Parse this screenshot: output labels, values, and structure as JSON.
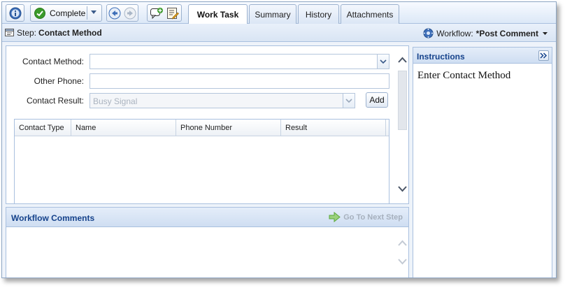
{
  "toolbar": {
    "complete_label": "Complete",
    "icons": [
      "info-icon",
      "check-icon",
      "back-icon",
      "forward-icon",
      "add-comment-icon",
      "edit-list-icon"
    ]
  },
  "tabs": [
    {
      "label": "Work Task",
      "active": true
    },
    {
      "label": "Summary",
      "active": false
    },
    {
      "label": "History",
      "active": false
    },
    {
      "label": "Attachments",
      "active": false
    }
  ],
  "step": {
    "prefix": "Step:",
    "name": "Contact Method",
    "workflow_label": "Workflow:",
    "workflow_value": "*Post Comment"
  },
  "form": {
    "contact_method_label": "Contact Method:",
    "contact_method_value": "",
    "other_phone_label": "Other Phone:",
    "other_phone_value": "",
    "contact_result_label": "Contact Result:",
    "contact_result_value": "Busy Signal",
    "add_label": "Add"
  },
  "grid": {
    "columns": [
      "Contact Type",
      "Name",
      "Phone Number",
      "Result"
    ],
    "rows": []
  },
  "comments": {
    "title": "Workflow Comments",
    "next_step_label": "Go To Next Step"
  },
  "instructions": {
    "title": "Instructions",
    "text": "Enter Contact Method"
  },
  "colors": {
    "header_text": "#15428b",
    "border": "#a9c0df",
    "check_green": "#3a9a2a"
  }
}
